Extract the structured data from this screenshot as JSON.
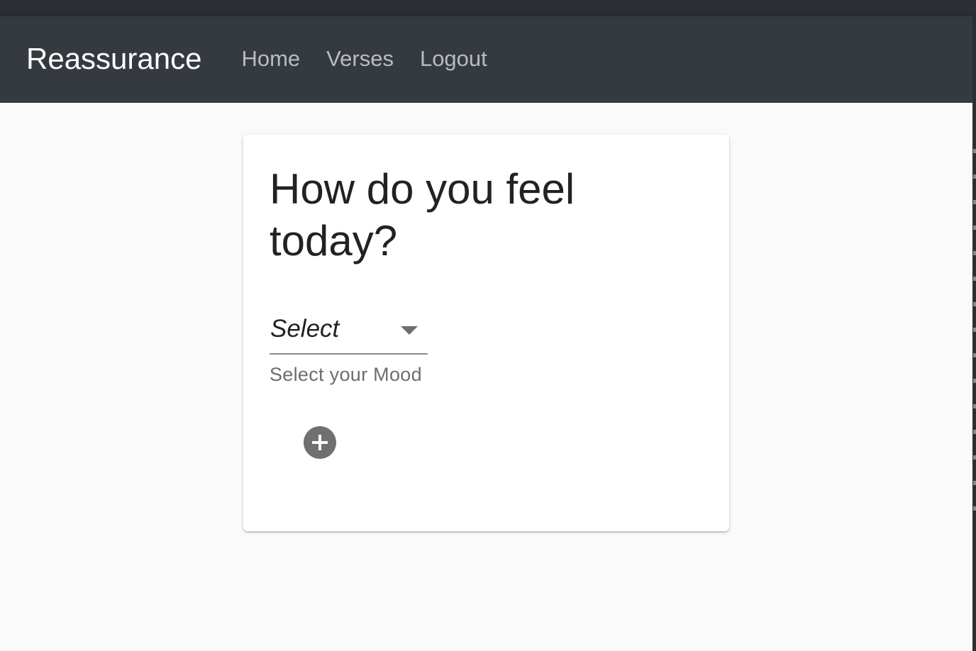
{
  "navbar": {
    "brand": "Reassurance",
    "links": [
      {
        "label": "Home"
      },
      {
        "label": "Verses"
      },
      {
        "label": "Logout"
      }
    ]
  },
  "card": {
    "title": "How do you feel today?",
    "mood_select": {
      "value": "Select",
      "helper": "Select your Mood",
      "icon": "chevron-down-icon"
    },
    "add_button": {
      "icon": "plus-circle-icon"
    }
  },
  "colors": {
    "navbar_bg": "#343a40",
    "page_bg": "#fafafa",
    "brand_text": "#ffffff",
    "nav_link_text": "#b9bcbf",
    "add_button_bg": "#707070"
  }
}
